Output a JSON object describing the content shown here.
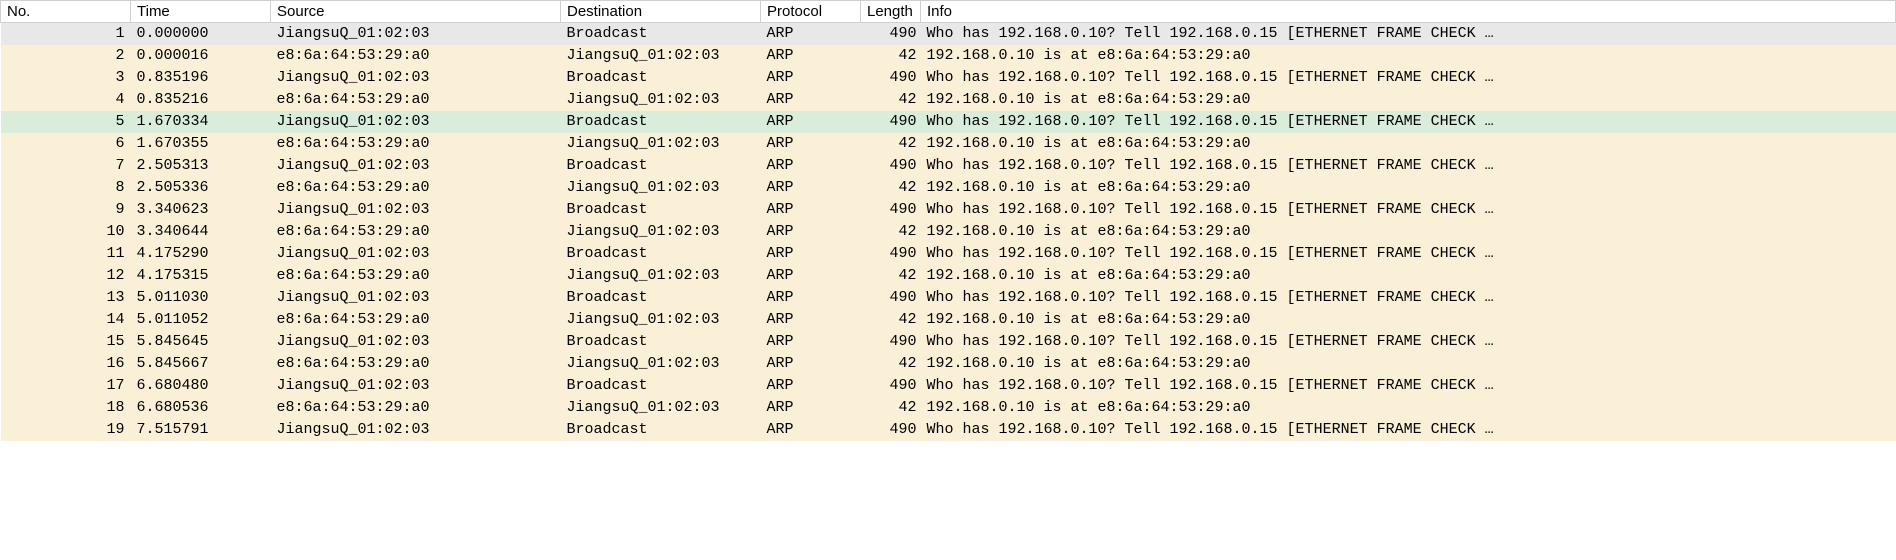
{
  "columns": {
    "no": "No.",
    "time": "Time",
    "source": "Source",
    "destination": "Destination",
    "protocol": "Protocol",
    "length": "Length",
    "info": "Info"
  },
  "rows": [
    {
      "no": "1",
      "time": "0.000000",
      "source": "JiangsuQ_01:02:03",
      "destination": "Broadcast",
      "protocol": "ARP",
      "length": "490",
      "info": "Who has 192.168.0.10? Tell 192.168.0.15 [ETHERNET FRAME CHECK …",
      "style": "selected"
    },
    {
      "no": "2",
      "time": "0.000016",
      "source": "e8:6a:64:53:29:a0",
      "destination": "JiangsuQ_01:02:03",
      "protocol": "ARP",
      "length": "42",
      "info": "192.168.0.10 is at e8:6a:64:53:29:a0",
      "style": "neutral"
    },
    {
      "no": "3",
      "time": "0.835196",
      "source": "JiangsuQ_01:02:03",
      "destination": "Broadcast",
      "protocol": "ARP",
      "length": "490",
      "info": "Who has 192.168.0.10? Tell 192.168.0.15 [ETHERNET FRAME CHECK …",
      "style": "neutral"
    },
    {
      "no": "4",
      "time": "0.835216",
      "source": "e8:6a:64:53:29:a0",
      "destination": "JiangsuQ_01:02:03",
      "protocol": "ARP",
      "length": "42",
      "info": "192.168.0.10 is at e8:6a:64:53:29:a0",
      "style": "neutral"
    },
    {
      "no": "5",
      "time": "1.670334",
      "source": "JiangsuQ_01:02:03",
      "destination": "Broadcast",
      "protocol": "ARP",
      "length": "490",
      "info": "Who has 192.168.0.10? Tell 192.168.0.15 [ETHERNET FRAME CHECK …",
      "style": "highlight"
    },
    {
      "no": "6",
      "time": "1.670355",
      "source": "e8:6a:64:53:29:a0",
      "destination": "JiangsuQ_01:02:03",
      "protocol": "ARP",
      "length": "42",
      "info": "192.168.0.10 is at e8:6a:64:53:29:a0",
      "style": "neutral"
    },
    {
      "no": "7",
      "time": "2.505313",
      "source": "JiangsuQ_01:02:03",
      "destination": "Broadcast",
      "protocol": "ARP",
      "length": "490",
      "info": "Who has 192.168.0.10? Tell 192.168.0.15 [ETHERNET FRAME CHECK …",
      "style": "neutral"
    },
    {
      "no": "8",
      "time": "2.505336",
      "source": "e8:6a:64:53:29:a0",
      "destination": "JiangsuQ_01:02:03",
      "protocol": "ARP",
      "length": "42",
      "info": "192.168.0.10 is at e8:6a:64:53:29:a0",
      "style": "neutral"
    },
    {
      "no": "9",
      "time": "3.340623",
      "source": "JiangsuQ_01:02:03",
      "destination": "Broadcast",
      "protocol": "ARP",
      "length": "490",
      "info": "Who has 192.168.0.10? Tell 192.168.0.15 [ETHERNET FRAME CHECK …",
      "style": "neutral"
    },
    {
      "no": "10",
      "time": "3.340644",
      "source": "e8:6a:64:53:29:a0",
      "destination": "JiangsuQ_01:02:03",
      "protocol": "ARP",
      "length": "42",
      "info": "192.168.0.10 is at e8:6a:64:53:29:a0",
      "style": "neutral"
    },
    {
      "no": "11",
      "time": "4.175290",
      "source": "JiangsuQ_01:02:03",
      "destination": "Broadcast",
      "protocol": "ARP",
      "length": "490",
      "info": "Who has 192.168.0.10? Tell 192.168.0.15 [ETHERNET FRAME CHECK …",
      "style": "neutral"
    },
    {
      "no": "12",
      "time": "4.175315",
      "source": "e8:6a:64:53:29:a0",
      "destination": "JiangsuQ_01:02:03",
      "protocol": "ARP",
      "length": "42",
      "info": "192.168.0.10 is at e8:6a:64:53:29:a0",
      "style": "neutral"
    },
    {
      "no": "13",
      "time": "5.011030",
      "source": "JiangsuQ_01:02:03",
      "destination": "Broadcast",
      "protocol": "ARP",
      "length": "490",
      "info": "Who has 192.168.0.10? Tell 192.168.0.15 [ETHERNET FRAME CHECK …",
      "style": "neutral"
    },
    {
      "no": "14",
      "time": "5.011052",
      "source": "e8:6a:64:53:29:a0",
      "destination": "JiangsuQ_01:02:03",
      "protocol": "ARP",
      "length": "42",
      "info": "192.168.0.10 is at e8:6a:64:53:29:a0",
      "style": "neutral"
    },
    {
      "no": "15",
      "time": "5.845645",
      "source": "JiangsuQ_01:02:03",
      "destination": "Broadcast",
      "protocol": "ARP",
      "length": "490",
      "info": "Who has 192.168.0.10? Tell 192.168.0.15 [ETHERNET FRAME CHECK …",
      "style": "neutral"
    },
    {
      "no": "16",
      "time": "5.845667",
      "source": "e8:6a:64:53:29:a0",
      "destination": "JiangsuQ_01:02:03",
      "protocol": "ARP",
      "length": "42",
      "info": "192.168.0.10 is at e8:6a:64:53:29:a0",
      "style": "neutral"
    },
    {
      "no": "17",
      "time": "6.680480",
      "source": "JiangsuQ_01:02:03",
      "destination": "Broadcast",
      "protocol": "ARP",
      "length": "490",
      "info": "Who has 192.168.0.10? Tell 192.168.0.15 [ETHERNET FRAME CHECK …",
      "style": "neutral"
    },
    {
      "no": "18",
      "time": "6.680536",
      "source": "e8:6a:64:53:29:a0",
      "destination": "JiangsuQ_01:02:03",
      "protocol": "ARP",
      "length": "42",
      "info": "192.168.0.10 is at e8:6a:64:53:29:a0",
      "style": "neutral"
    },
    {
      "no": "19",
      "time": "7.515791",
      "source": "JiangsuQ_01:02:03",
      "destination": "Broadcast",
      "protocol": "ARP",
      "length": "490",
      "info": "Who has 192.168.0.10? Tell 192.168.0.15 [ETHERNET FRAME CHECK …",
      "style": "neutral"
    }
  ]
}
